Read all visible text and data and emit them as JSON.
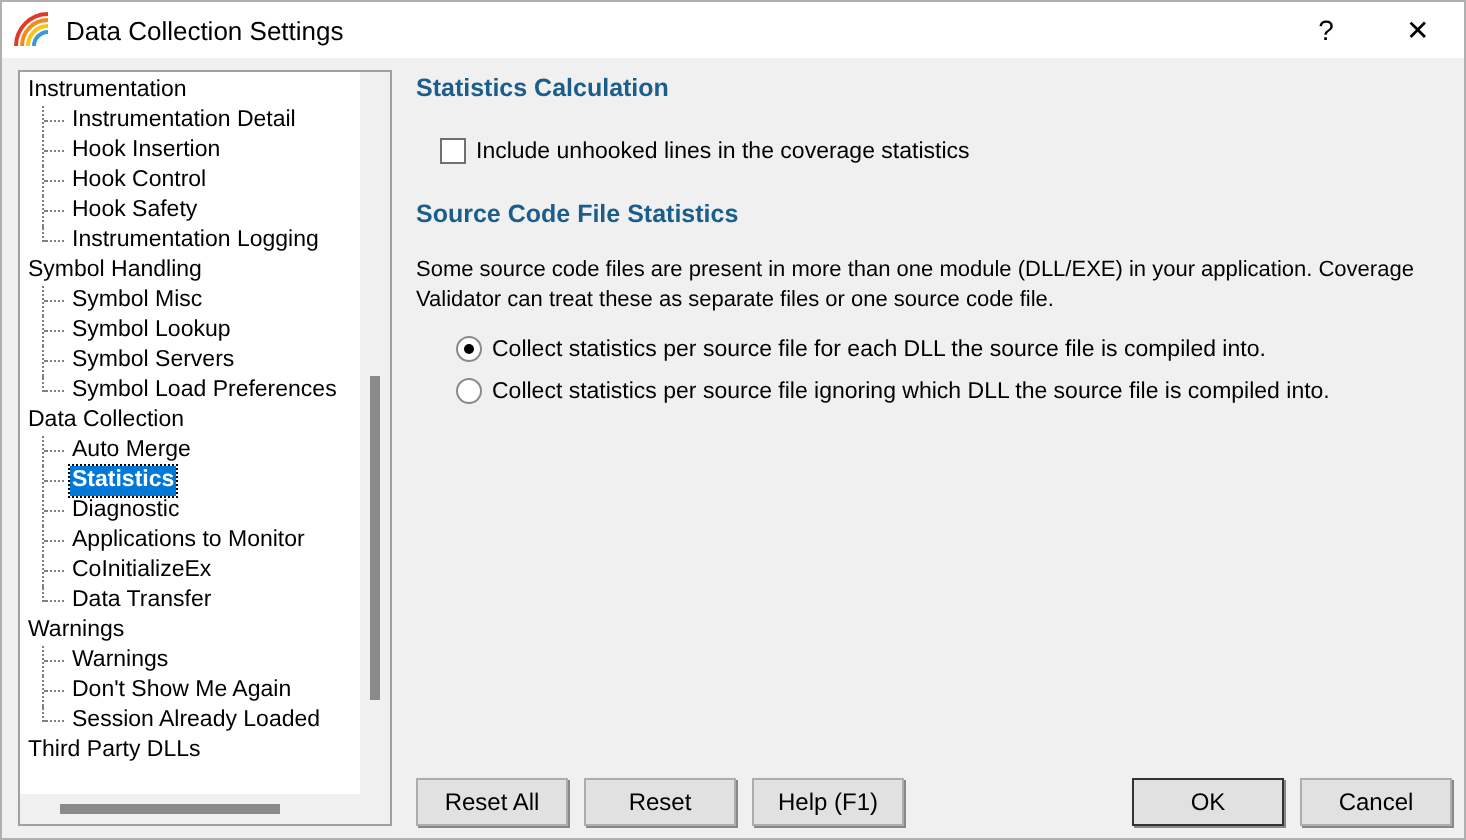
{
  "window": {
    "title": "Data Collection Settings",
    "help": "?",
    "close": "✕"
  },
  "tree": [
    {
      "label": "Instrumentation",
      "selected": false,
      "children": [
        {
          "label": "Instrumentation Detail",
          "selected": false
        },
        {
          "label": "Hook Insertion",
          "selected": false
        },
        {
          "label": "Hook Control",
          "selected": false
        },
        {
          "label": "Hook Safety",
          "selected": false
        },
        {
          "label": "Instrumentation Logging",
          "selected": false
        }
      ]
    },
    {
      "label": "Symbol Handling",
      "selected": false,
      "children": [
        {
          "label": "Symbol Misc",
          "selected": false
        },
        {
          "label": "Symbol Lookup",
          "selected": false
        },
        {
          "label": "Symbol Servers",
          "selected": false
        },
        {
          "label": "Symbol Load Preferences",
          "selected": false
        }
      ]
    },
    {
      "label": "Data Collection",
      "selected": false,
      "children": [
        {
          "label": "Auto Merge",
          "selected": false
        },
        {
          "label": "Statistics",
          "selected": true
        },
        {
          "label": "Diagnostic",
          "selected": false
        },
        {
          "label": "Applications to Monitor",
          "selected": false
        },
        {
          "label": "CoInitializeEx",
          "selected": false
        },
        {
          "label": "Data Transfer",
          "selected": false
        }
      ]
    },
    {
      "label": "Warnings",
      "selected": false,
      "children": [
        {
          "label": "Warnings",
          "selected": false
        },
        {
          "label": "Don't Show Me Again",
          "selected": false
        },
        {
          "label": "Session Already Loaded",
          "selected": false
        }
      ]
    },
    {
      "label": "Third Party DLLs",
      "selected": false
    }
  ],
  "sections": [
    {
      "heading": "Statistics Calculation",
      "options": [
        {
          "kind": "checkbox",
          "label": "Include unhooked lines in the coverage statistics",
          "checked": false
        }
      ]
    },
    {
      "heading": "Source Code File Statistics",
      "description": "Some source code files are present in more than one module (DLL/EXE) in your application. Coverage Validator can treat these as separate files or one source code file.",
      "options": [
        {
          "kind": "radio",
          "label": "Collect statistics per source file for each DLL the source file is compiled into.",
          "checked": true
        },
        {
          "kind": "radio",
          "label": "Collect statistics per source file ignoring which DLL the source file is compiled into.",
          "checked": false
        }
      ]
    }
  ],
  "buttons_left": [
    "Reset All",
    "Reset",
    "Help (F1)"
  ],
  "buttons_right": [
    "OK",
    "Cancel"
  ]
}
